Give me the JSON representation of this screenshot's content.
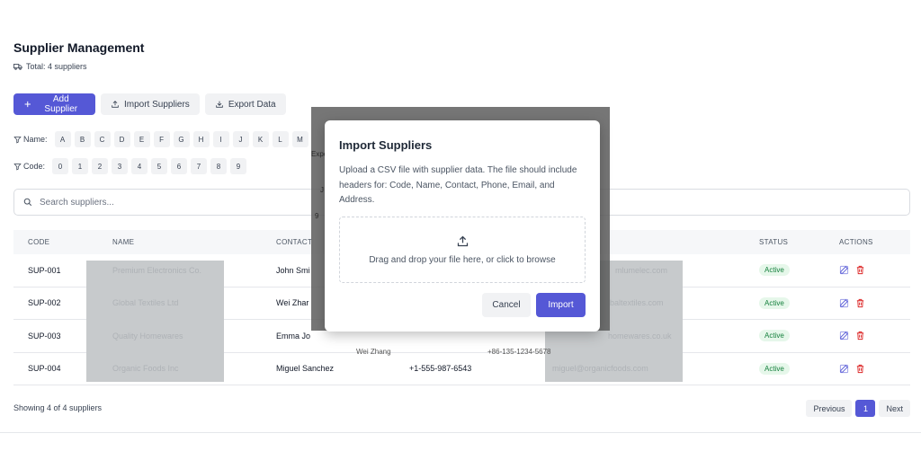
{
  "header": {
    "title": "Supplier Management",
    "total": "Total: 4 suppliers"
  },
  "toolbar": {
    "add_label": "Add Supplier",
    "import_label": "Import Suppliers",
    "export_label": "Export Data"
  },
  "filters": {
    "name_label": "Name:",
    "name_letters": [
      "A",
      "B",
      "C",
      "D",
      "E",
      "F",
      "G",
      "H",
      "I",
      "J",
      "K",
      "L",
      "M"
    ],
    "code_label": "Code:",
    "code_digits": [
      "0",
      "1",
      "2",
      "3",
      "4",
      "5",
      "6",
      "7",
      "8",
      "9"
    ]
  },
  "search": {
    "placeholder": "Search suppliers..."
  },
  "table": {
    "headers": {
      "code": "CODE",
      "name": "NAME",
      "contact": "CONTACT",
      "status": "STATUS",
      "actions": "ACTIONS"
    },
    "rows": [
      {
        "code": "SUP-001",
        "name": "Premium Electronics Co.",
        "contact": "John Smi",
        "phone": "",
        "email": "mlumelec.com",
        "status": "Active"
      },
      {
        "code": "SUP-002",
        "name": "Global Textiles Ltd",
        "contact": "Wei Zhar",
        "phone": "",
        "email": "baltextiles.com",
        "status": "Active"
      },
      {
        "code": "SUP-003",
        "name": "Quality Homewares",
        "contact": "Emma Jo",
        "phone": "",
        "email": "homewares.co.uk",
        "status": "Active"
      },
      {
        "code": "SUP-004",
        "name": "Organic Foods Inc",
        "contact": "Miguel Sanchez",
        "phone": "+1-555-987-6543",
        "email": "miguel@organicfoods.com",
        "status": "Active"
      }
    ]
  },
  "footer": {
    "showing": "Showing 4 of 4 suppliers",
    "prev": "Previous",
    "page": "1",
    "next": "Next"
  },
  "overlay_ghost": {
    "a": "Expo",
    "b": "J",
    "c": "9",
    "d": "Wei Zhang",
    "e": "+86-135-1234-5678"
  },
  "modal": {
    "title": "Import Suppliers",
    "description": "Upload a CSV file with supplier data. The file should include headers for: Code, Name, Contact, Phone, Email, and Address.",
    "dropzone_text": "Drag and drop your file here, or click to browse",
    "cancel_label": "Cancel",
    "import_label": "Import"
  },
  "colors": {
    "primary": "#5558d6",
    "active_badge_bg": "#e6f7ea",
    "active_badge_text": "#15803d",
    "delete": "#dc2626"
  }
}
